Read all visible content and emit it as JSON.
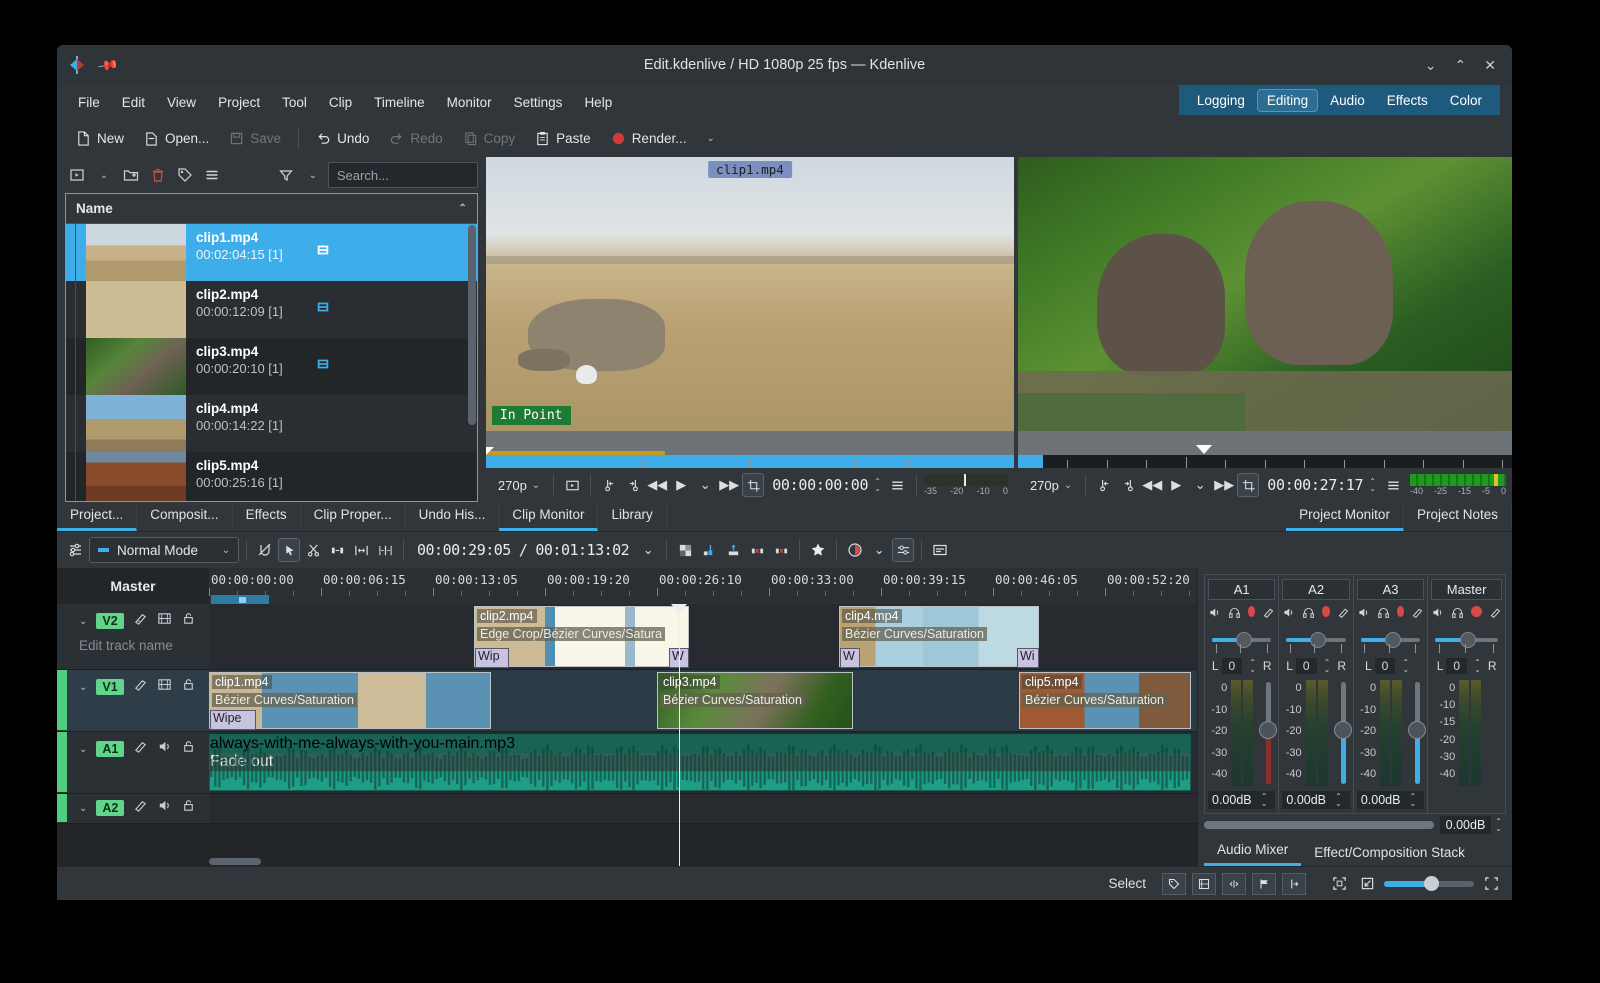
{
  "window": {
    "title": "Edit.kdenlive / HD 1080p 25 fps — Kdenlive",
    "minimize": "⌄",
    "maximize": "⌃",
    "close": "✕"
  },
  "menu": [
    "File",
    "Edit",
    "View",
    "Project",
    "Tool",
    "Clip",
    "Timeline",
    "Monitor",
    "Settings",
    "Help"
  ],
  "layout_modes": {
    "items": [
      "Logging",
      "Editing",
      "Audio",
      "Effects",
      "Color"
    ],
    "active": "Editing"
  },
  "toolbar": {
    "new": "New",
    "open": "Open...",
    "save": "Save",
    "undo": "Undo",
    "redo": "Redo",
    "copy": "Copy",
    "paste": "Paste",
    "render": "Render...",
    "render_more": "⌄"
  },
  "bin": {
    "search_placeholder": "Search...",
    "column_header": "Name",
    "sort_arrow": "⌃",
    "clips": [
      {
        "name": "clip1.mp4",
        "duration": "00:02:04:15 [1]",
        "selected": true,
        "has_icon": true
      },
      {
        "name": "clip2.mp4",
        "duration": "00:00:12:09 [1]",
        "selected": false,
        "has_icon": true
      },
      {
        "name": "clip3.mp4",
        "duration": "00:00:20:10 [1]",
        "selected": false,
        "has_icon": true
      },
      {
        "name": "clip4.mp4",
        "duration": "00:00:14:22 [1]",
        "selected": false,
        "has_icon": false
      },
      {
        "name": "clip5.mp4",
        "duration": "00:00:25:16 [1]",
        "selected": false,
        "has_icon": false
      }
    ]
  },
  "clip_monitor": {
    "overlay_tag": "clip1.mp4",
    "in_point_label": "In Point",
    "resolution": "270p",
    "timecode": "00:00:00:00",
    "meter_scale": [
      "-35",
      "-20",
      "-10",
      "0"
    ]
  },
  "project_monitor": {
    "resolution": "270p",
    "timecode": "00:00:27:17",
    "meter_scale": [
      "-40",
      "-25",
      "-15",
      "-5",
      "0"
    ]
  },
  "panel_tabs": {
    "left": [
      "Project...",
      "Composit...",
      "Effects",
      "Clip Proper...",
      "Undo His...",
      "Clip Monitor",
      "Library"
    ],
    "left_active": "Project...",
    "left_active2": "Clip Monitor",
    "right": [
      "Project Monitor",
      "Project Notes"
    ],
    "right_active": "Project Monitor"
  },
  "timeline_toolbar": {
    "edit_mode": "Normal Mode",
    "position": "00:00:29:05",
    "duration": "00:01:13:02",
    "separator": "/"
  },
  "timeline": {
    "master_label": "Master",
    "ruler_labels": [
      "00:00:00:00",
      "00:00:06:15",
      "00:00:13:05",
      "00:00:19:20",
      "00:00:26:10",
      "00:00:33:00",
      "00:00:39:15",
      "00:00:46:05",
      "00:00:52:20"
    ],
    "tracks": [
      {
        "id": "V2",
        "name_placeholder": "Edit track name",
        "type": "video"
      },
      {
        "id": "V1",
        "name_placeholder": "",
        "type": "video"
      },
      {
        "id": "A1",
        "name_placeholder": "",
        "type": "audio"
      },
      {
        "id": "A2",
        "name_placeholder": "",
        "type": "audio"
      }
    ],
    "clips_v2": [
      {
        "name": "clip2.mp4",
        "effects": "Edge Crop/Bézier Curves/Satura",
        "comp_left": "Wip",
        "comp_right": "W"
      },
      {
        "name": "clip4.mp4",
        "effects": "Bézier Curves/Saturation",
        "comp_left": "W",
        "comp_right": "Wi"
      }
    ],
    "clips_v1": [
      {
        "name": "clip1.mp4",
        "effects": "Bézier Curves/Saturation",
        "comp_left": "Wipe"
      },
      {
        "name": "clip3.mp4",
        "effects": "Bézier Curves/Saturation"
      },
      {
        "name": "clip5.mp4",
        "effects": "Bézier Curves/Saturation"
      }
    ],
    "clips_a1": [
      {
        "name": "always-with-me-always-with-you-main.mp3",
        "effects": "Fade out"
      }
    ]
  },
  "mixer": {
    "strips": [
      {
        "name": "A1",
        "pan_l": "L",
        "pan_value": "0",
        "pan_r": "R",
        "gain": "0.00dB",
        "scale": [
          "0",
          "-10",
          "-20",
          "-30",
          "-40"
        ]
      },
      {
        "name": "A2",
        "pan_l": "L",
        "pan_value": "0",
        "pan_r": "R",
        "gain": "0.00dB",
        "scale": [
          "0",
          "-10",
          "-20",
          "-30",
          "-40"
        ]
      },
      {
        "name": "A3",
        "pan_l": "L",
        "pan_value": "0",
        "pan_r": "",
        "gain": "0.00dB",
        "scale": [
          "0",
          "-10",
          "-20",
          "-30",
          "-40"
        ]
      }
    ],
    "master": {
      "name": "Master",
      "pan_l": "L",
      "pan_value": "0",
      "pan_r": "R",
      "gain": "0.00dB",
      "scale": [
        "0",
        "-10",
        "-15",
        "-20",
        "-30",
        "-40"
      ]
    },
    "tabs": [
      "Audio Mixer",
      "Effect/Composition Stack"
    ],
    "active_tab": "Audio Mixer"
  },
  "statusbar": {
    "message": "Select"
  },
  "colors": {
    "accent": "#3daee9",
    "panel": "#31363b",
    "dark": "#232629",
    "track_green": "#4fcf7e",
    "audio_clip": "#1f9e87",
    "record_red": "#d84a4a",
    "mode_bar": "#1e5a7d"
  }
}
